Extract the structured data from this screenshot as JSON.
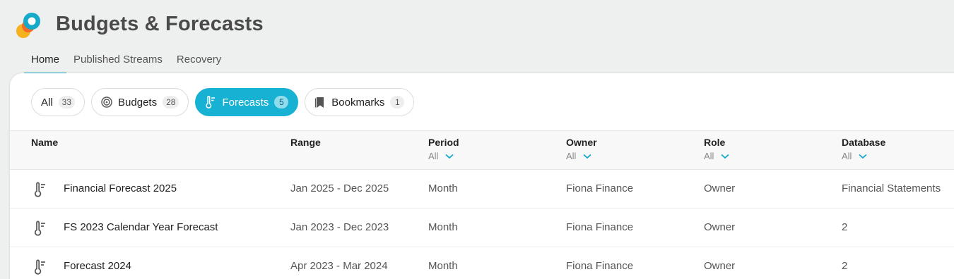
{
  "app": {
    "title": "Budgets & Forecasts"
  },
  "nav": {
    "tabs": [
      {
        "label": "Home",
        "active": true
      },
      {
        "label": "Published Streams",
        "active": false
      },
      {
        "label": "Recovery",
        "active": false
      }
    ]
  },
  "chips": [
    {
      "label": "All",
      "count": "33",
      "icon": "none",
      "active": false
    },
    {
      "label": "Budgets",
      "count": "28",
      "icon": "target-icon",
      "active": false
    },
    {
      "label": "Forecasts",
      "count": "5",
      "icon": "forecast-thermometer-icon",
      "active": true
    },
    {
      "label": "Bookmarks",
      "count": "1",
      "icon": "bookmark-icon",
      "active": false
    }
  ],
  "table": {
    "columns": [
      {
        "label": "Name",
        "filter": ""
      },
      {
        "label": "Range",
        "filter": ""
      },
      {
        "label": "Period",
        "filter": "All"
      },
      {
        "label": "Owner",
        "filter": "All"
      },
      {
        "label": "Role",
        "filter": "All"
      },
      {
        "label": "Database",
        "filter": "All"
      }
    ],
    "rows": [
      {
        "name": "Financial Forecast 2025",
        "range": "Jan 2025 - Dec 2025",
        "period": "Month",
        "owner": "Fiona Finance",
        "role": "Owner",
        "database": "Financial Statements"
      },
      {
        "name": "FS 2023 Calendar Year Forecast",
        "range": "Jan 2023 - Dec 2023",
        "period": "Month",
        "owner": "Fiona Finance",
        "role": "Owner",
        "database": "2"
      },
      {
        "name": "Forecast 2024",
        "range": "Apr 2023 - Mar 2024",
        "period": "Month",
        "owner": "Fiona Finance",
        "role": "Owner",
        "database": "2"
      }
    ]
  },
  "colors": {
    "accent": "#17b1d3",
    "logo_teal": "#17a9c9",
    "logo_orange": "#f26b2a",
    "logo_yellow": "#f5b21e"
  }
}
